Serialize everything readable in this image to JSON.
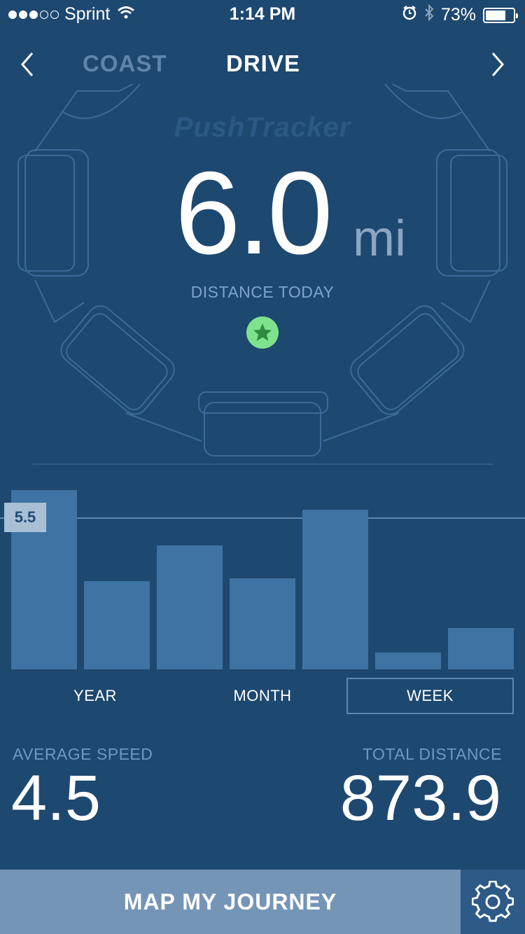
{
  "status_bar": {
    "carrier": "Sprint",
    "time": "1:14 PM",
    "battery": "73%",
    "battery_level": 0.73
  },
  "nav": {
    "tabs": [
      {
        "label": "COAST",
        "active": false
      },
      {
        "label": "DRIVE",
        "active": true
      }
    ]
  },
  "hero": {
    "brand": "PushTracker",
    "value": "6.0",
    "unit": "mi",
    "label": "DISTANCE TODAY",
    "badge_icon": "star-icon"
  },
  "chart_data": {
    "type": "bar",
    "values": [
      6.5,
      3.2,
      4.5,
      3.3,
      5.8,
      0.6,
      1.5
    ],
    "reference_line": 5.5,
    "reference_label": "5.5",
    "ylim": [
      0,
      6.5
    ]
  },
  "periods": [
    {
      "label": "YEAR",
      "selected": false
    },
    {
      "label": "MONTH",
      "selected": false
    },
    {
      "label": "WEEK",
      "selected": true
    }
  ],
  "stats": {
    "average_speed_label": "AVERAGE SPEED",
    "average_speed_value": "4.5",
    "total_distance_label": "TOTAL DISTANCE",
    "total_distance_value": "873.9"
  },
  "footer": {
    "journey_button": "MAP MY JOURNEY",
    "settings_icon": "gear-icon"
  },
  "colors": {
    "background": "#1d4870",
    "bar": "#3f73a3",
    "badge": "#7ee28c",
    "button": "#7495b6"
  }
}
